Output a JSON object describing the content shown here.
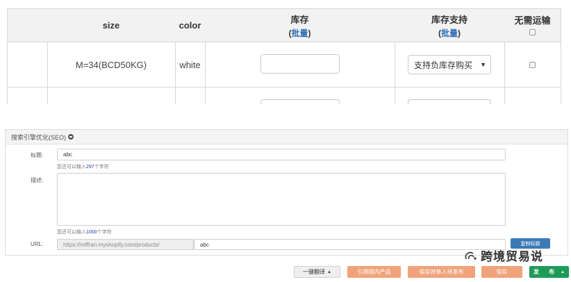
{
  "variant_table": {
    "headers": {
      "size": "size",
      "color": "color",
      "stock": "库存",
      "stock_batch": "批量",
      "stock_support": "库存支持",
      "stock_support_batch": "批量",
      "no_shipping": "无需运输"
    },
    "rows": [
      {
        "size": "M=34(BCD50KG)",
        "color": "white",
        "stock_value": "",
        "support_option": "支持负库存购买"
      }
    ]
  },
  "seo": {
    "header": "搜索引擎优化(SEO)",
    "title_label": "标题:",
    "title_value": "abc",
    "title_hint_prefix": "您还可以输入",
    "title_hint_count": "297",
    "title_hint_suffix": "个字符",
    "desc_label": "描述:",
    "desc_value": "",
    "desc_hint_prefix": "您还可以输入",
    "desc_hint_count": "1000",
    "desc_hint_suffix": "个字符",
    "url_label": "URL:",
    "url_prefix": "https://miffran.myshopify.com/products/",
    "url_value": "abc",
    "copy_button": "复制标题"
  },
  "actions": {
    "translate": "一键翻译",
    "reference": "引用国内产品",
    "save_move": "保存并移入待发布",
    "save": "保存",
    "publish": "发 布"
  },
  "watermark": "跨境贸易说",
  "colors": {
    "link": "#2d6db5",
    "orange": "#f0a37a",
    "green": "#1e9b58",
    "blue_btn": "#3c7ab6"
  }
}
